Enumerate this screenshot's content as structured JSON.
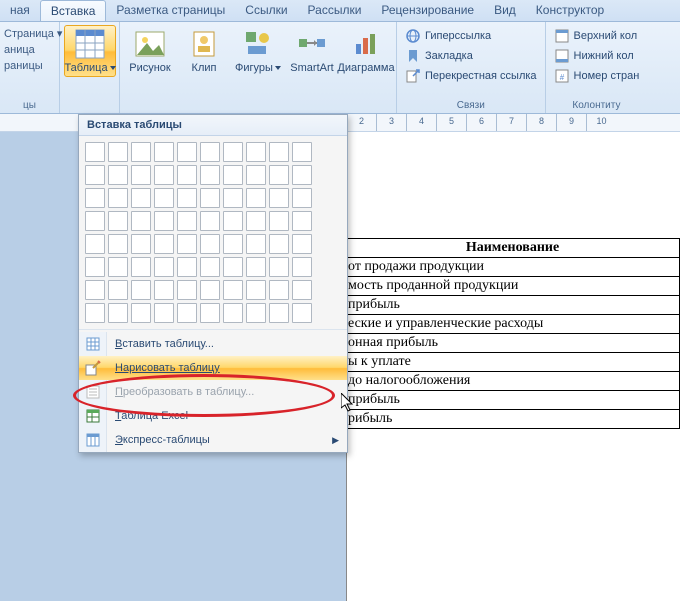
{
  "tabs": [
    "ная",
    "Вставка",
    "Разметка страницы",
    "Ссылки",
    "Рассылки",
    "Рецензирование",
    "Вид",
    "Конструктор"
  ],
  "active_tab": 1,
  "left_cut": {
    "items": [
      "Страница ▾",
      "аница",
      "раницы"
    ],
    "label": "цы"
  },
  "groups": {
    "tables": {
      "btn": "Таблица"
    },
    "illustrations": {
      "items": [
        "Рисунок",
        "Клип",
        "Фигуры",
        "SmartArt",
        "Диаграмма"
      ]
    },
    "links": {
      "items": [
        "Гиперссылка",
        "Закладка",
        "Перекрестная ссылка"
      ],
      "label": "Связи"
    },
    "header_footer": {
      "items": [
        "Верхний кол",
        "Нижний кол",
        "Номер стран"
      ],
      "label": "Колонтиту"
    }
  },
  "ruler": [
    "2",
    "3",
    "4",
    "5",
    "6",
    "7",
    "8",
    "9",
    "10"
  ],
  "dropdown": {
    "title": "Вставка таблицы",
    "grid_cols": 10,
    "grid_rows": 8,
    "items": [
      {
        "key": "insert",
        "label": "Вставить таблицу...",
        "label_accel": "В",
        "disabled": false
      },
      {
        "key": "draw",
        "label": "Нарисовать таблицу",
        "label_accel": "Н",
        "hot": true
      },
      {
        "key": "convert",
        "label": "Преобразовать в таблицу...",
        "label_accel": "П",
        "disabled": true
      },
      {
        "key": "excel",
        "label": "Таблица Excel",
        "label_accel": "Т"
      },
      {
        "key": "quick",
        "label": "Экспресс-таблицы",
        "label_accel": "Э",
        "submenu": true
      }
    ]
  },
  "doc": {
    "header": "Наименование",
    "rows": [
      " от продажи продукции",
      "мость проданной  продукции",
      "прибыль",
      "еские и управленческие расходы",
      "онная прибыль",
      "ы к уплате",
      " до налогообложения",
      "прибыль",
      "рибыль"
    ]
  }
}
